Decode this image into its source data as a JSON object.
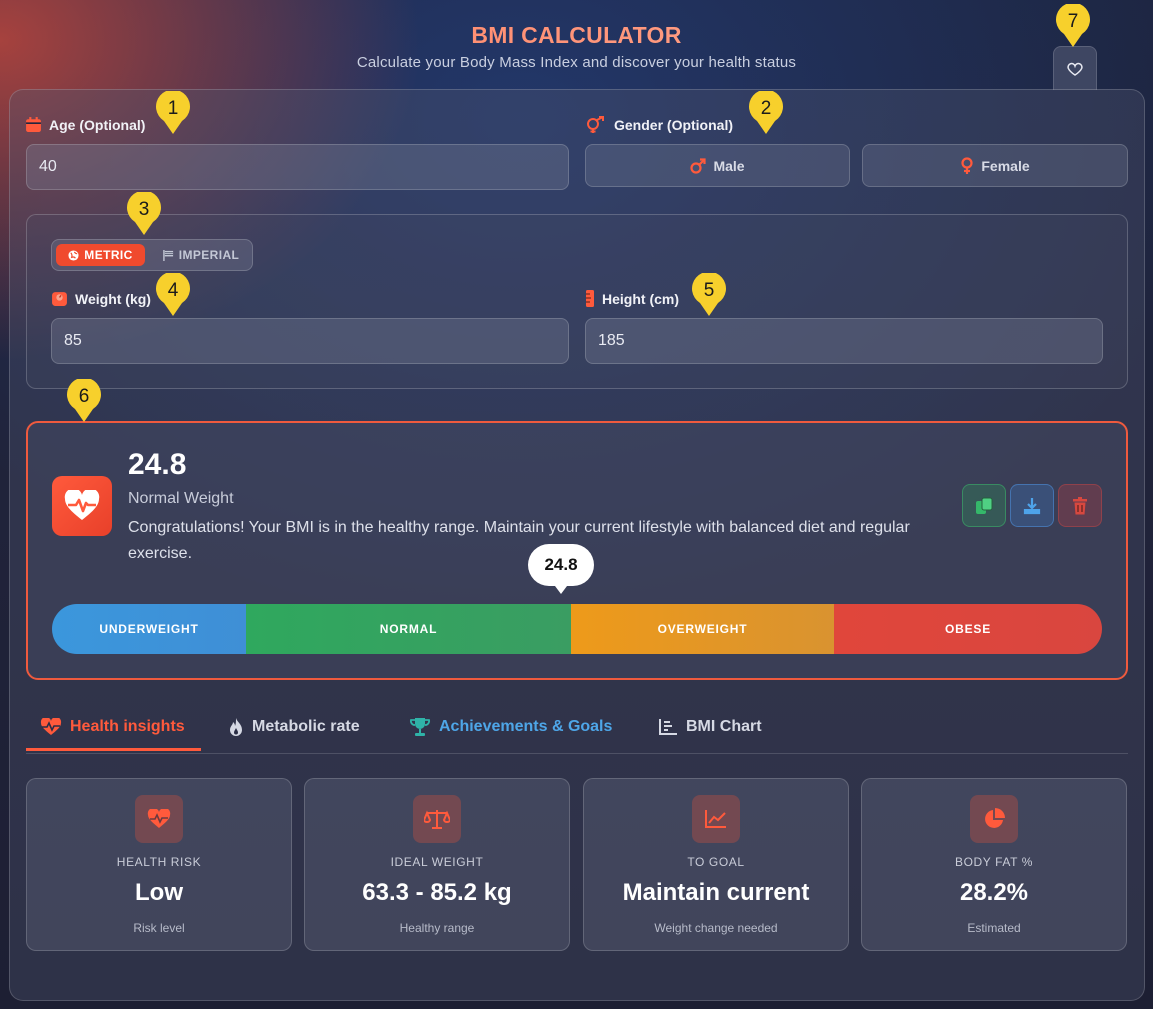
{
  "header": {
    "title": "BMI CALCULATOR",
    "subtitle": "Calculate your Body Mass Index and discover your health status"
  },
  "markers": [
    "1",
    "2",
    "3",
    "4",
    "5",
    "6",
    "7"
  ],
  "age": {
    "label": "Age (Optional)",
    "value": "40"
  },
  "gender": {
    "label": "Gender (Optional)",
    "male": "Male",
    "female": "Female"
  },
  "units": {
    "metric": "METRIC",
    "imperial": "IMPERIAL"
  },
  "weight": {
    "label": "Weight (kg)",
    "value": "85"
  },
  "height": {
    "label": "Height (cm)",
    "value": "185"
  },
  "result": {
    "bmi": "24.8",
    "category": "Normal Weight",
    "message": "Congratulations! Your BMI is in the healthy range. Maintain your current lifestyle with balanced diet and regular exercise.",
    "bubble": "24.8"
  },
  "scale": {
    "underweight": "UNDERWEIGHT",
    "normal": "NORMAL",
    "overweight": "OVERWEIGHT",
    "obese": "OBESE"
  },
  "tabs": {
    "insights": "Health insights",
    "metabolic": "Metabolic rate",
    "achievements": "Achievements & Goals",
    "chart": "BMI Chart"
  },
  "cards": {
    "risk": {
      "title": "HEALTH RISK",
      "value": "Low",
      "sub": "Risk level"
    },
    "ideal": {
      "title": "IDEAL WEIGHT",
      "value": "63.3 - 85.2 kg",
      "sub": "Healthy range"
    },
    "goal": {
      "title": "TO GOAL",
      "value": "Maintain current",
      "sub": "Weight change needed"
    },
    "fat": {
      "title": "BODY FAT %",
      "value": "28.2%",
      "sub": "Estimated"
    }
  },
  "colors": {
    "accent": "#ff5a3c",
    "underweight": "#3b97dc",
    "normal": "#2fa85e",
    "overweight": "#e79a1f",
    "obese": "#e0463b",
    "marker": "#f7d02c"
  }
}
